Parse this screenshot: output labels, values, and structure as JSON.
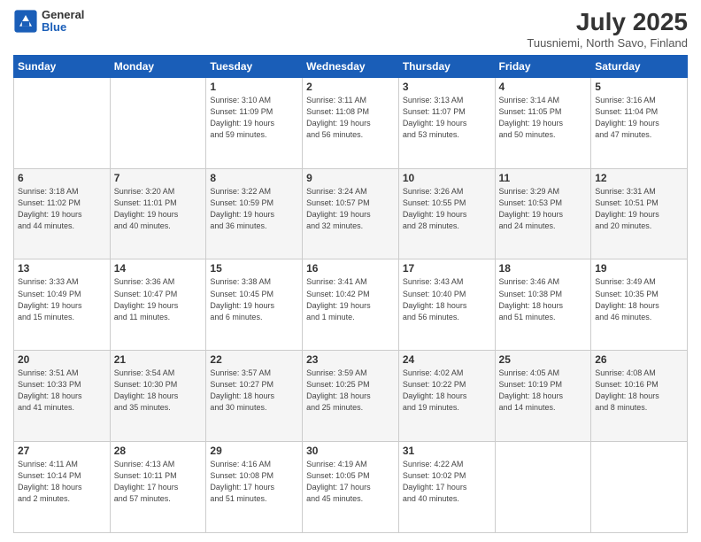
{
  "header": {
    "logo": {
      "general": "General",
      "blue": "Blue"
    },
    "title": "July 2025",
    "subtitle": "Tuusniemi, North Savo, Finland"
  },
  "days_of_week": [
    "Sunday",
    "Monday",
    "Tuesday",
    "Wednesday",
    "Thursday",
    "Friday",
    "Saturday"
  ],
  "weeks": [
    [
      {
        "day": "",
        "info": ""
      },
      {
        "day": "",
        "info": ""
      },
      {
        "day": "1",
        "info": "Sunrise: 3:10 AM\nSunset: 11:09 PM\nDaylight: 19 hours\nand 59 minutes."
      },
      {
        "day": "2",
        "info": "Sunrise: 3:11 AM\nSunset: 11:08 PM\nDaylight: 19 hours\nand 56 minutes."
      },
      {
        "day": "3",
        "info": "Sunrise: 3:13 AM\nSunset: 11:07 PM\nDaylight: 19 hours\nand 53 minutes."
      },
      {
        "day": "4",
        "info": "Sunrise: 3:14 AM\nSunset: 11:05 PM\nDaylight: 19 hours\nand 50 minutes."
      },
      {
        "day": "5",
        "info": "Sunrise: 3:16 AM\nSunset: 11:04 PM\nDaylight: 19 hours\nand 47 minutes."
      }
    ],
    [
      {
        "day": "6",
        "info": "Sunrise: 3:18 AM\nSunset: 11:02 PM\nDaylight: 19 hours\nand 44 minutes."
      },
      {
        "day": "7",
        "info": "Sunrise: 3:20 AM\nSunset: 11:01 PM\nDaylight: 19 hours\nand 40 minutes."
      },
      {
        "day": "8",
        "info": "Sunrise: 3:22 AM\nSunset: 10:59 PM\nDaylight: 19 hours\nand 36 minutes."
      },
      {
        "day": "9",
        "info": "Sunrise: 3:24 AM\nSunset: 10:57 PM\nDaylight: 19 hours\nand 32 minutes."
      },
      {
        "day": "10",
        "info": "Sunrise: 3:26 AM\nSunset: 10:55 PM\nDaylight: 19 hours\nand 28 minutes."
      },
      {
        "day": "11",
        "info": "Sunrise: 3:29 AM\nSunset: 10:53 PM\nDaylight: 19 hours\nand 24 minutes."
      },
      {
        "day": "12",
        "info": "Sunrise: 3:31 AM\nSunset: 10:51 PM\nDaylight: 19 hours\nand 20 minutes."
      }
    ],
    [
      {
        "day": "13",
        "info": "Sunrise: 3:33 AM\nSunset: 10:49 PM\nDaylight: 19 hours\nand 15 minutes."
      },
      {
        "day": "14",
        "info": "Sunrise: 3:36 AM\nSunset: 10:47 PM\nDaylight: 19 hours\nand 11 minutes."
      },
      {
        "day": "15",
        "info": "Sunrise: 3:38 AM\nSunset: 10:45 PM\nDaylight: 19 hours\nand 6 minutes."
      },
      {
        "day": "16",
        "info": "Sunrise: 3:41 AM\nSunset: 10:42 PM\nDaylight: 19 hours\nand 1 minute."
      },
      {
        "day": "17",
        "info": "Sunrise: 3:43 AM\nSunset: 10:40 PM\nDaylight: 18 hours\nand 56 minutes."
      },
      {
        "day": "18",
        "info": "Sunrise: 3:46 AM\nSunset: 10:38 PM\nDaylight: 18 hours\nand 51 minutes."
      },
      {
        "day": "19",
        "info": "Sunrise: 3:49 AM\nSunset: 10:35 PM\nDaylight: 18 hours\nand 46 minutes."
      }
    ],
    [
      {
        "day": "20",
        "info": "Sunrise: 3:51 AM\nSunset: 10:33 PM\nDaylight: 18 hours\nand 41 minutes."
      },
      {
        "day": "21",
        "info": "Sunrise: 3:54 AM\nSunset: 10:30 PM\nDaylight: 18 hours\nand 35 minutes."
      },
      {
        "day": "22",
        "info": "Sunrise: 3:57 AM\nSunset: 10:27 PM\nDaylight: 18 hours\nand 30 minutes."
      },
      {
        "day": "23",
        "info": "Sunrise: 3:59 AM\nSunset: 10:25 PM\nDaylight: 18 hours\nand 25 minutes."
      },
      {
        "day": "24",
        "info": "Sunrise: 4:02 AM\nSunset: 10:22 PM\nDaylight: 18 hours\nand 19 minutes."
      },
      {
        "day": "25",
        "info": "Sunrise: 4:05 AM\nSunset: 10:19 PM\nDaylight: 18 hours\nand 14 minutes."
      },
      {
        "day": "26",
        "info": "Sunrise: 4:08 AM\nSunset: 10:16 PM\nDaylight: 18 hours\nand 8 minutes."
      }
    ],
    [
      {
        "day": "27",
        "info": "Sunrise: 4:11 AM\nSunset: 10:14 PM\nDaylight: 18 hours\nand 2 minutes."
      },
      {
        "day": "28",
        "info": "Sunrise: 4:13 AM\nSunset: 10:11 PM\nDaylight: 17 hours\nand 57 minutes."
      },
      {
        "day": "29",
        "info": "Sunrise: 4:16 AM\nSunset: 10:08 PM\nDaylight: 17 hours\nand 51 minutes."
      },
      {
        "day": "30",
        "info": "Sunrise: 4:19 AM\nSunset: 10:05 PM\nDaylight: 17 hours\nand 45 minutes."
      },
      {
        "day": "31",
        "info": "Sunrise: 4:22 AM\nSunset: 10:02 PM\nDaylight: 17 hours\nand 40 minutes."
      },
      {
        "day": "",
        "info": ""
      },
      {
        "day": "",
        "info": ""
      }
    ]
  ]
}
